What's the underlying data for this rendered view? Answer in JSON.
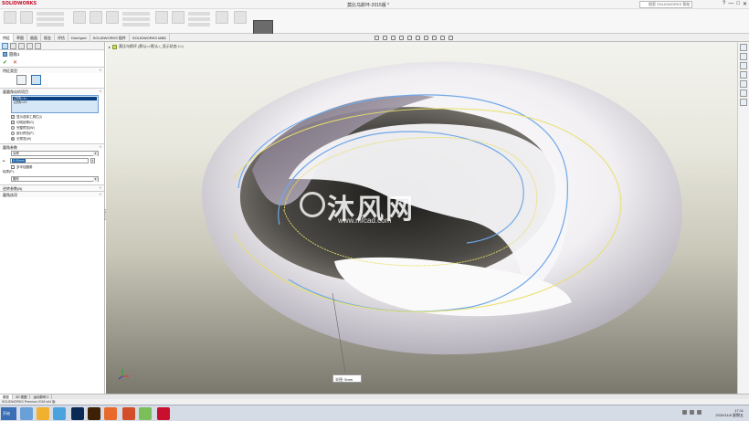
{
  "titlebar": {
    "logo": "SOLIDWORKS",
    "window_title": "莫比乌斯环-2015版 *",
    "search_placeholder": "搜索 SOLIDWORKS 帮助",
    "help": "?",
    "min": "—",
    "max": "□",
    "close": "✕"
  },
  "ribbon": {
    "instant3d": "Instant3D"
  },
  "tabs": [
    {
      "label": "特征"
    },
    {
      "label": "草图"
    },
    {
      "label": "曲面"
    },
    {
      "label": "钣金"
    },
    {
      "label": "评估"
    },
    {
      "label": "DimXpert"
    },
    {
      "label": "SOLIDWORKS 插件"
    },
    {
      "label": "SOLIDWORKS MBD"
    }
  ],
  "panel": {
    "feature_title": "圆角1",
    "ok": "✔",
    "cancel": "✕",
    "sections": {
      "fillet_type": "特征类型",
      "items_to_fillet": "要圆角化的项目",
      "fillet_params": "圆角参数",
      "offset_params": "逆转参数(B)",
      "fillet_options": "圆角选项"
    },
    "list_items": [
      "边线<1>",
      "边线<2>"
    ],
    "checkboxes": [
      {
        "label": "显示选择工具栏(I)",
        "checked": true
      },
      {
        "label": "切线延伸(G)",
        "checked": true
      }
    ],
    "radios": [
      {
        "label": "完整预览(W)",
        "checked": false
      },
      {
        "label": "部分预览(P)",
        "checked": false
      },
      {
        "label": "无预览(W)",
        "checked": true
      }
    ],
    "fillet_method": "对称",
    "radius_value": "5.00mm",
    "multi_radius_label": "多半径圆角",
    "profile_label": "轮廓(P):",
    "profile_value": "圆形"
  },
  "viewport": {
    "tree_item": "莫比乌斯环 (默认<<默认>_显示状态 1>)",
    "callout": "半径: 5mm",
    "watermark_big": "沐风网",
    "watermark_small": "www.mfcad.com"
  },
  "bottom_tabs": [
    {
      "label": "模型"
    },
    {
      "label": "3D 视图"
    },
    {
      "label": "运动算例 1"
    }
  ],
  "status_text": "SOLIDWORKS Premium 2018 x64 版",
  "taskbar": {
    "start": "开始",
    "time": "17:11",
    "date": "2020/11/6 星期五"
  },
  "colors": {
    "accent": "#2c6fb4",
    "logo_red": "#c8102e",
    "edge_blue": "#6fa8e8",
    "edge_yellow": "#e8e06a"
  }
}
